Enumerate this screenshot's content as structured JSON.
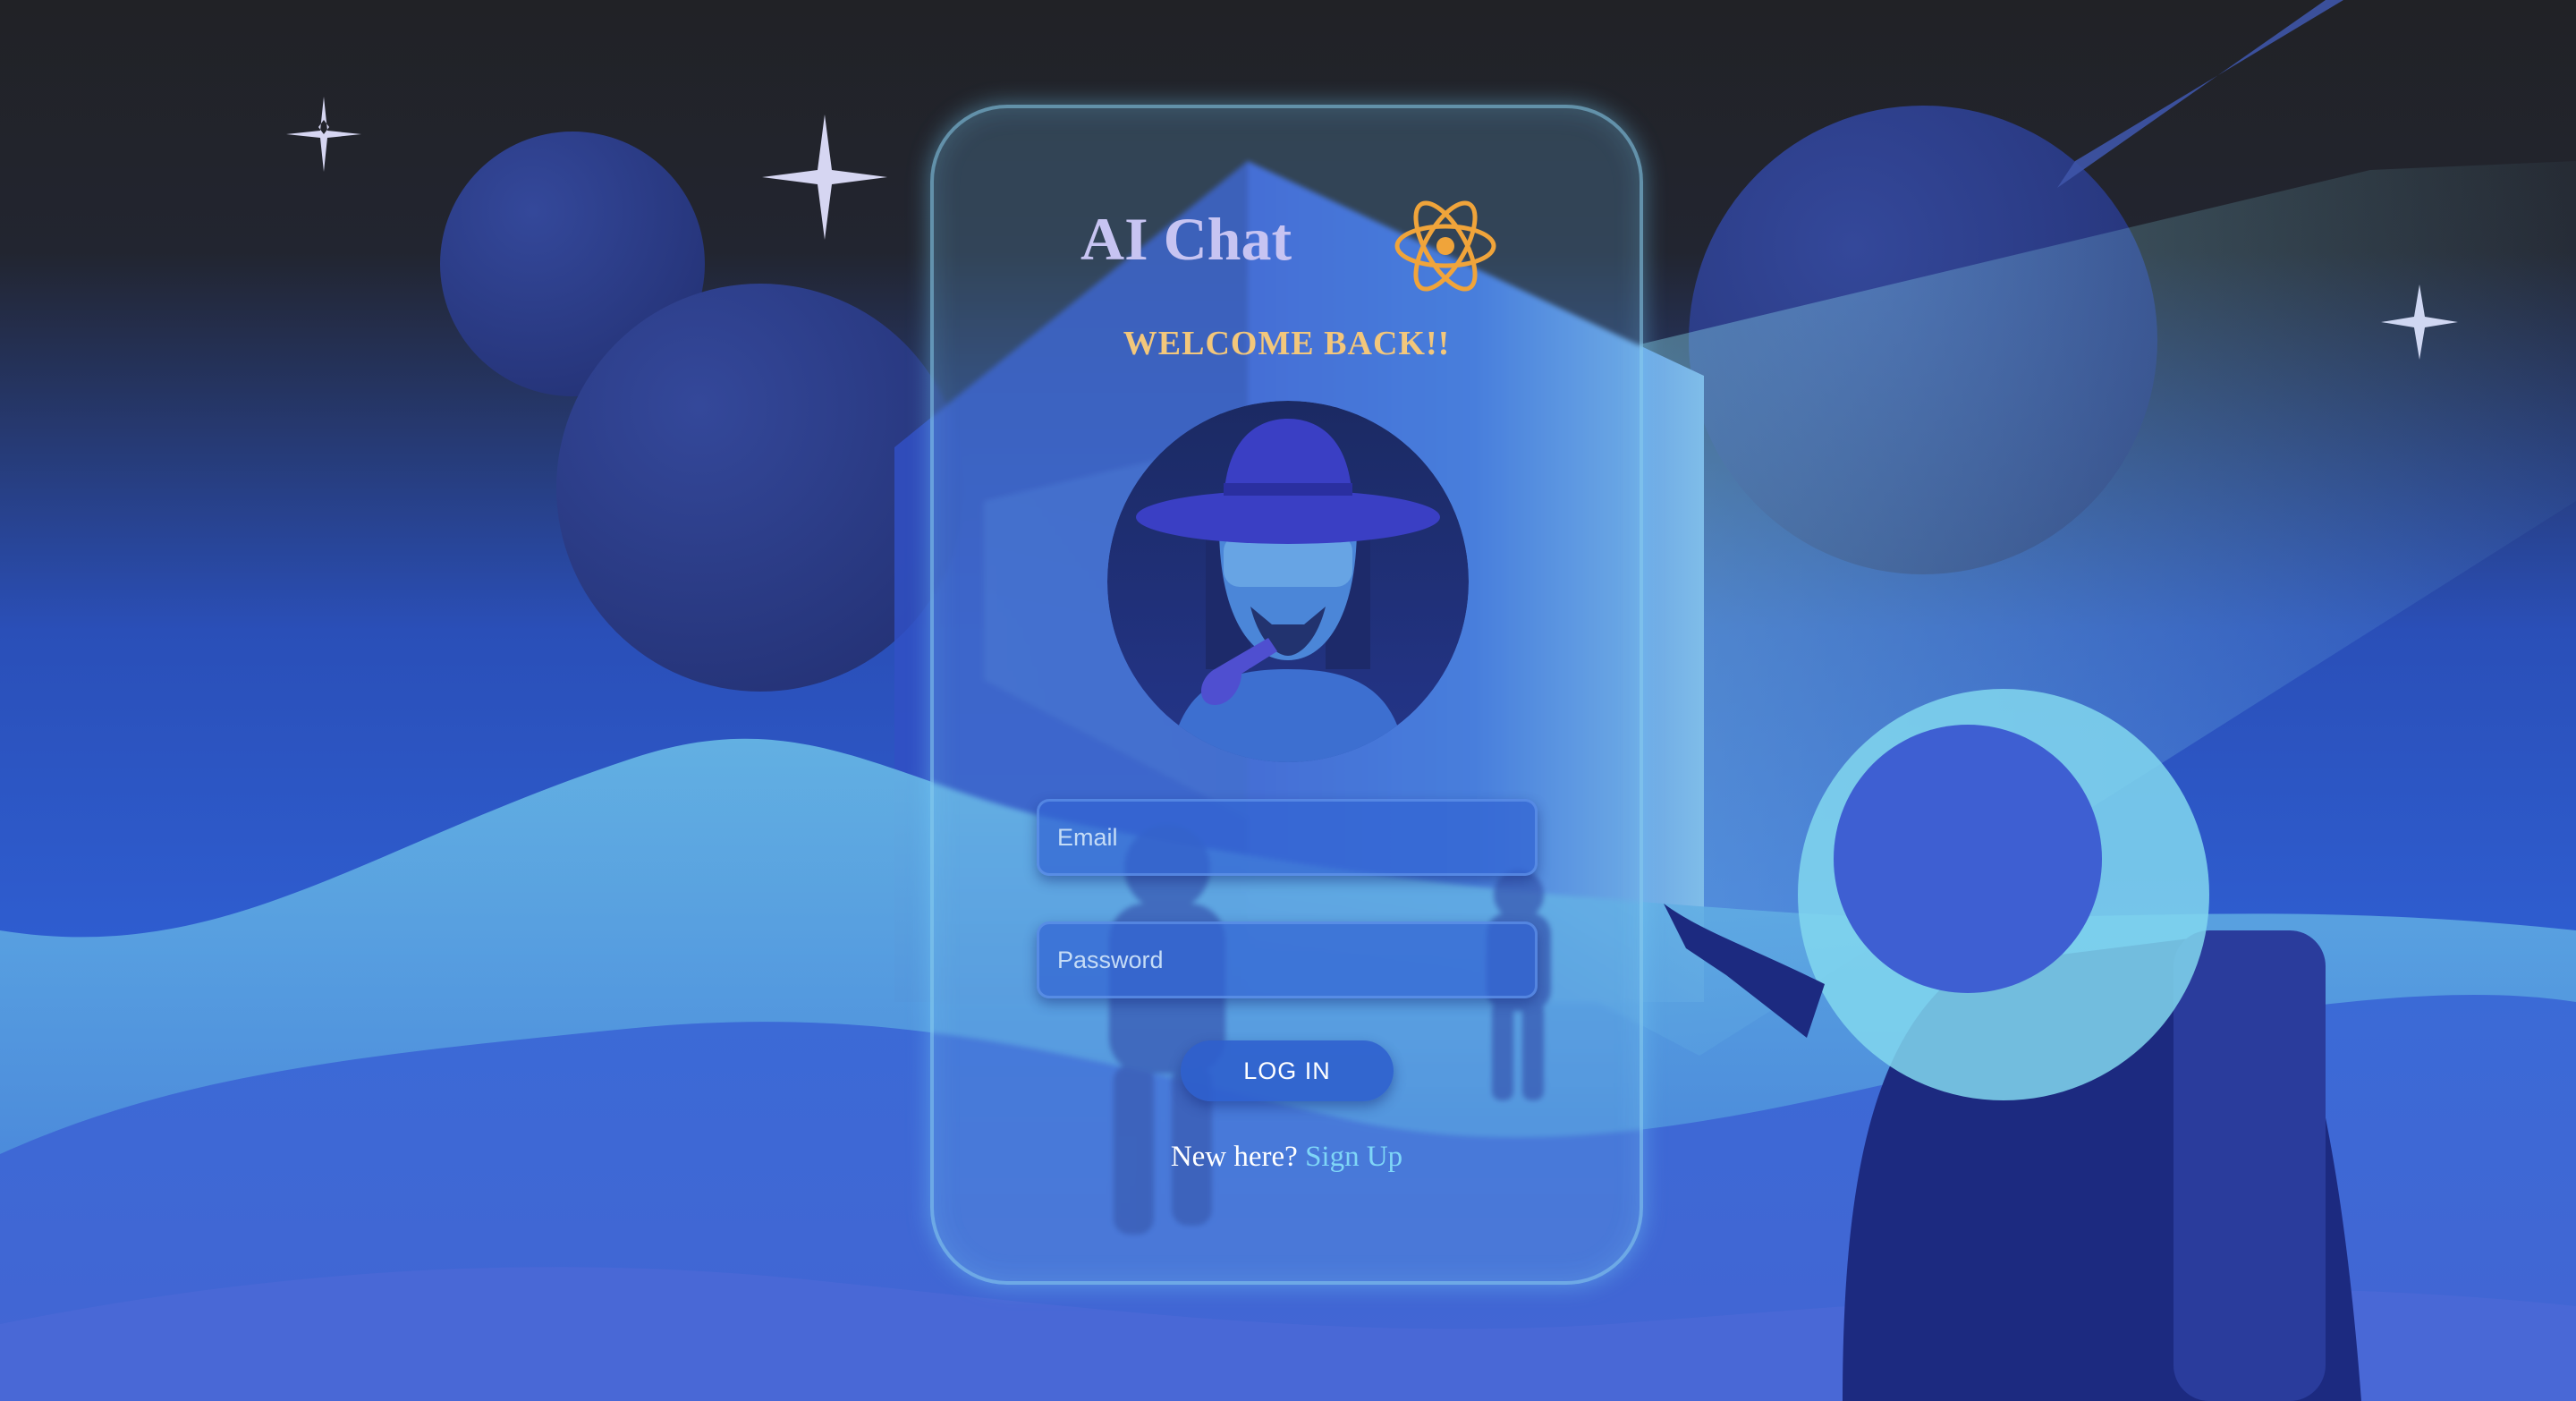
{
  "app": {
    "title": "AI Chat",
    "logo_icon": "atom-icon"
  },
  "login": {
    "welcome": "WELCOME BACK!!",
    "avatar_icon": "user-avatar",
    "email_placeholder": "Email",
    "password_placeholder": "Password",
    "login_label": "LOG IN",
    "signup_prompt": "New here?",
    "signup_link": "Sign Up"
  },
  "colors": {
    "title": "#c7c4f2",
    "welcome": "#f3c77b",
    "link": "#7fd6f7",
    "logo": "#f0a43a",
    "background_top": "#212226",
    "background_bottom": "#3f5fd2"
  }
}
